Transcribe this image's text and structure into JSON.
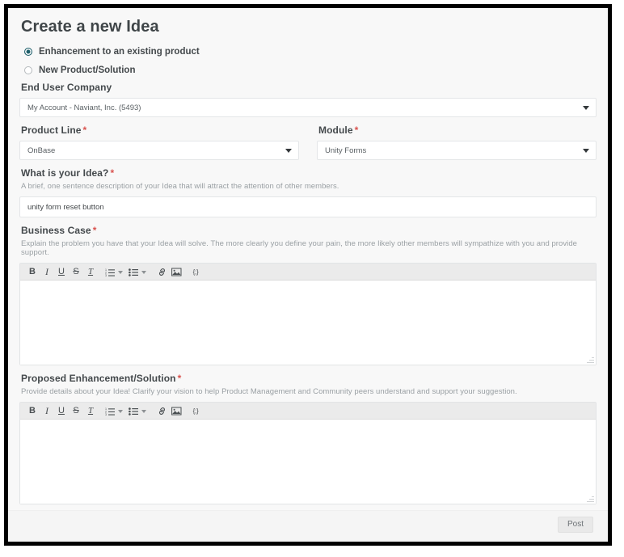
{
  "page": {
    "title": "Create a new Idea"
  },
  "idea_type": {
    "options": [
      {
        "label": "Enhancement to an existing product",
        "selected": true
      },
      {
        "label": "New Product/Solution",
        "selected": false
      }
    ]
  },
  "fields": {
    "end_user_company": {
      "label": "End User Company",
      "required": false,
      "value": "My Account - Naviant, Inc. (5493)"
    },
    "product_line": {
      "label": "Product Line",
      "required_mark": "*",
      "value": "OnBase"
    },
    "module": {
      "label": "Module",
      "required_mark": "*",
      "value": "Unity Forms"
    },
    "idea_title": {
      "label": "What is your Idea?",
      "required_mark": "*",
      "help": "A brief, one sentence description of your Idea that will attract the attention of other members.",
      "value": "unity form reset button"
    },
    "business_case": {
      "label": "Business Case",
      "required_mark": "*",
      "help": "Explain the problem you have that your Idea will solve. The more clearly you define your pain, the more likely other members will sympathize with you and provide support.",
      "value": ""
    },
    "proposed_solution": {
      "label": "Proposed Enhancement/Solution",
      "required_mark": "*",
      "help": "Provide details about your Idea! Clarify your vision to help Product Management and Community peers understand and support your suggestion.",
      "value": ""
    }
  },
  "editor_toolbar": {
    "buttons": [
      {
        "name": "bold",
        "glyph": "B"
      },
      {
        "name": "italic",
        "glyph": "I"
      },
      {
        "name": "underline",
        "glyph": "U"
      },
      {
        "name": "strikethrough",
        "glyph": "S"
      },
      {
        "name": "remove-format",
        "glyph": "T"
      },
      {
        "name": "numbered-list",
        "glyph": ""
      },
      {
        "name": "bulleted-list",
        "glyph": ""
      },
      {
        "name": "insert-link",
        "glyph": ""
      },
      {
        "name": "insert-image",
        "glyph": ""
      },
      {
        "name": "source-code",
        "glyph": "{;}"
      }
    ]
  },
  "footer": {
    "post_label": "Post"
  },
  "colors": {
    "accent": "#1f5f6b",
    "required": "#d9534f",
    "label": "#44494c",
    "help": "#9aa0a4",
    "toolbar_bg": "#ebebeb",
    "page_bg": "#f8f8f8"
  }
}
